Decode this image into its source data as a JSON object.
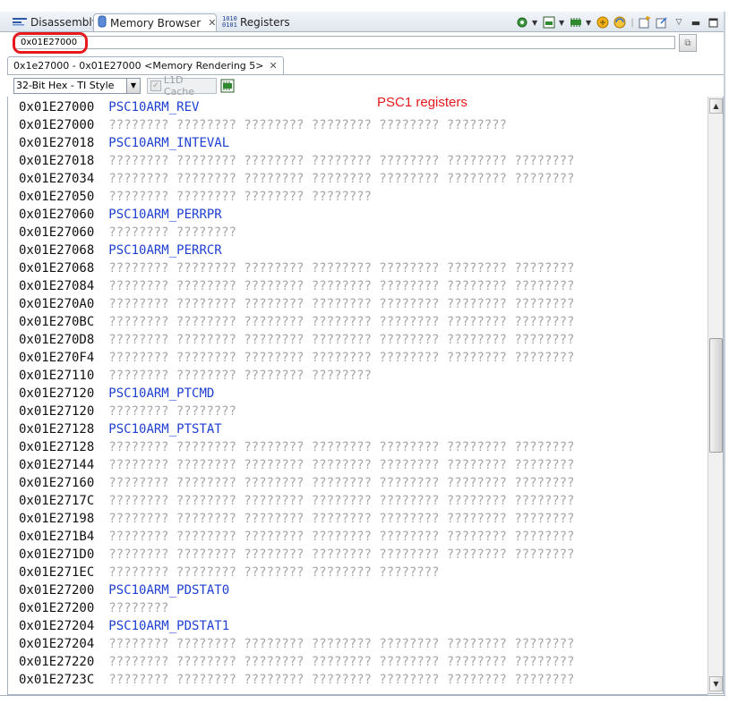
{
  "tabs": [
    {
      "label": "Disassembly",
      "icon": "disassembly-icon"
    },
    {
      "label": "Memory Browser",
      "icon": "memory-icon"
    },
    {
      "label": "Registers",
      "icon": "registers-icon"
    }
  ],
  "address_bar": {
    "value": "0x01E27000"
  },
  "rendering_tab": {
    "label": "0x1e27000 - 0x01E27000 <Memory Rendering 5>"
  },
  "format": {
    "selected": "32-Bit Hex - TI Style"
  },
  "cache_option": {
    "label": "L1D Cache",
    "checked": true,
    "enabled": false
  },
  "annotation": {
    "text": "PSC1 registers",
    "color": "#e8191d"
  },
  "memory_lines": [
    {
      "addr": "0x01E27000",
      "label": "PSC10ARM_REV"
    },
    {
      "addr": "0x01E27000",
      "data": "???????? ???????? ???????? ???????? ???????? ????????"
    },
    {
      "addr": "0x01E27018",
      "label": "PSC10ARM_INTEVAL"
    },
    {
      "addr": "0x01E27018",
      "data": "???????? ???????? ???????? ???????? ???????? ???????? ????????"
    },
    {
      "addr": "0x01E27034",
      "data": "???????? ???????? ???????? ???????? ???????? ???????? ????????"
    },
    {
      "addr": "0x01E27050",
      "data": "???????? ???????? ???????? ????????"
    },
    {
      "addr": "0x01E27060",
      "label": "PSC10ARM_PERRPR"
    },
    {
      "addr": "0x01E27060",
      "data": "???????? ????????"
    },
    {
      "addr": "0x01E27068",
      "label": "PSC10ARM_PERRCR"
    },
    {
      "addr": "0x01E27068",
      "data": "???????? ???????? ???????? ???????? ???????? ???????? ????????"
    },
    {
      "addr": "0x01E27084",
      "data": "???????? ???????? ???????? ???????? ???????? ???????? ????????"
    },
    {
      "addr": "0x01E270A0",
      "data": "???????? ???????? ???????? ???????? ???????? ???????? ????????"
    },
    {
      "addr": "0x01E270BC",
      "data": "???????? ???????? ???????? ???????? ???????? ???????? ????????"
    },
    {
      "addr": "0x01E270D8",
      "data": "???????? ???????? ???????? ???????? ???????? ???????? ????????"
    },
    {
      "addr": "0x01E270F4",
      "data": "???????? ???????? ???????? ???????? ???????? ???????? ????????"
    },
    {
      "addr": "0x01E27110",
      "data": "???????? ???????? ???????? ????????"
    },
    {
      "addr": "0x01E27120",
      "label": "PSC10ARM_PTCMD"
    },
    {
      "addr": "0x01E27120",
      "data": "???????? ????????"
    },
    {
      "addr": "0x01E27128",
      "label": "PSC10ARM_PTSTAT"
    },
    {
      "addr": "0x01E27128",
      "data": "???????? ???????? ???????? ???????? ???????? ???????? ????????"
    },
    {
      "addr": "0x01E27144",
      "data": "???????? ???????? ???????? ???????? ???????? ???????? ????????"
    },
    {
      "addr": "0x01E27160",
      "data": "???????? ???????? ???????? ???????? ???????? ???????? ????????"
    },
    {
      "addr": "0x01E2717C",
      "data": "???????? ???????? ???????? ???????? ???????? ???????? ????????"
    },
    {
      "addr": "0x01E27198",
      "data": "???????? ???????? ???????? ???????? ???????? ???????? ????????"
    },
    {
      "addr": "0x01E271B4",
      "data": "???????? ???????? ???????? ???????? ???????? ???????? ????????"
    },
    {
      "addr": "0x01E271D0",
      "data": "???????? ???????? ???????? ???????? ???????? ???????? ????????"
    },
    {
      "addr": "0x01E271EC",
      "data": "???????? ???????? ???????? ???????? ????????"
    },
    {
      "addr": "0x01E27200",
      "label": "PSC10ARM_PDSTAT0"
    },
    {
      "addr": "0x01E27200",
      "data": "????????"
    },
    {
      "addr": "0x01E27204",
      "label": "PSC10ARM_PDSTAT1"
    },
    {
      "addr": "0x01E27204",
      "data": "???????? ???????? ???????? ???????? ???????? ???????? ????????"
    },
    {
      "addr": "0x01E27220",
      "data": "???????? ???????? ???????? ???????? ???????? ???????? ????????"
    },
    {
      "addr": "0x01E2723C",
      "data": "???????? ???????? ???????? ???????? ???????? ???????? ????????"
    }
  ]
}
